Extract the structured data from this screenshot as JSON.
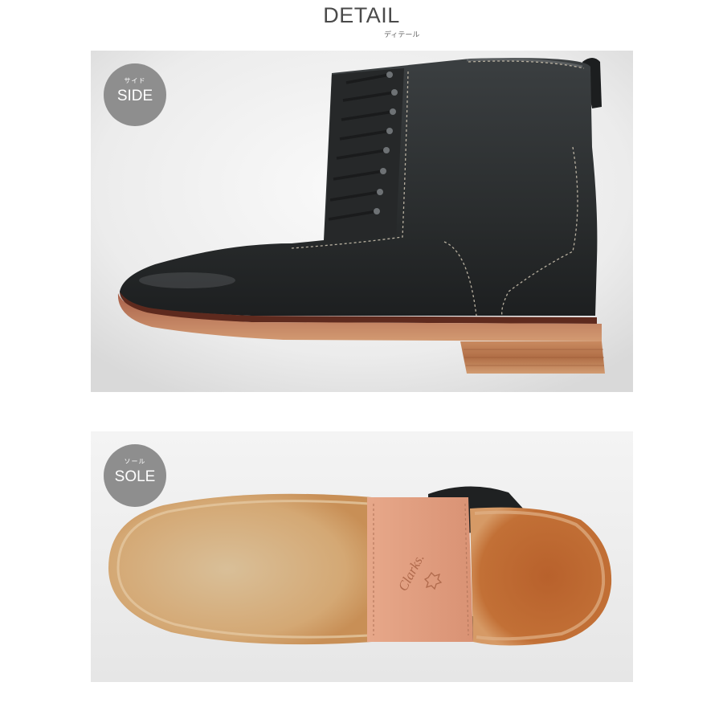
{
  "header": {
    "title": "DETAIL",
    "subtitle": "ディテール"
  },
  "panels": {
    "side": {
      "badge_small": "サイド",
      "badge_label": "SIDE"
    },
    "sole": {
      "badge_small": "ソール",
      "badge_label": "SOLE",
      "brand_mark": "Clarks."
    }
  },
  "colors": {
    "badge": "#8e8e8e",
    "leather": "#2a2d2e",
    "crepe_sole": "#d7a36f",
    "heel_block": "#c8804e"
  }
}
